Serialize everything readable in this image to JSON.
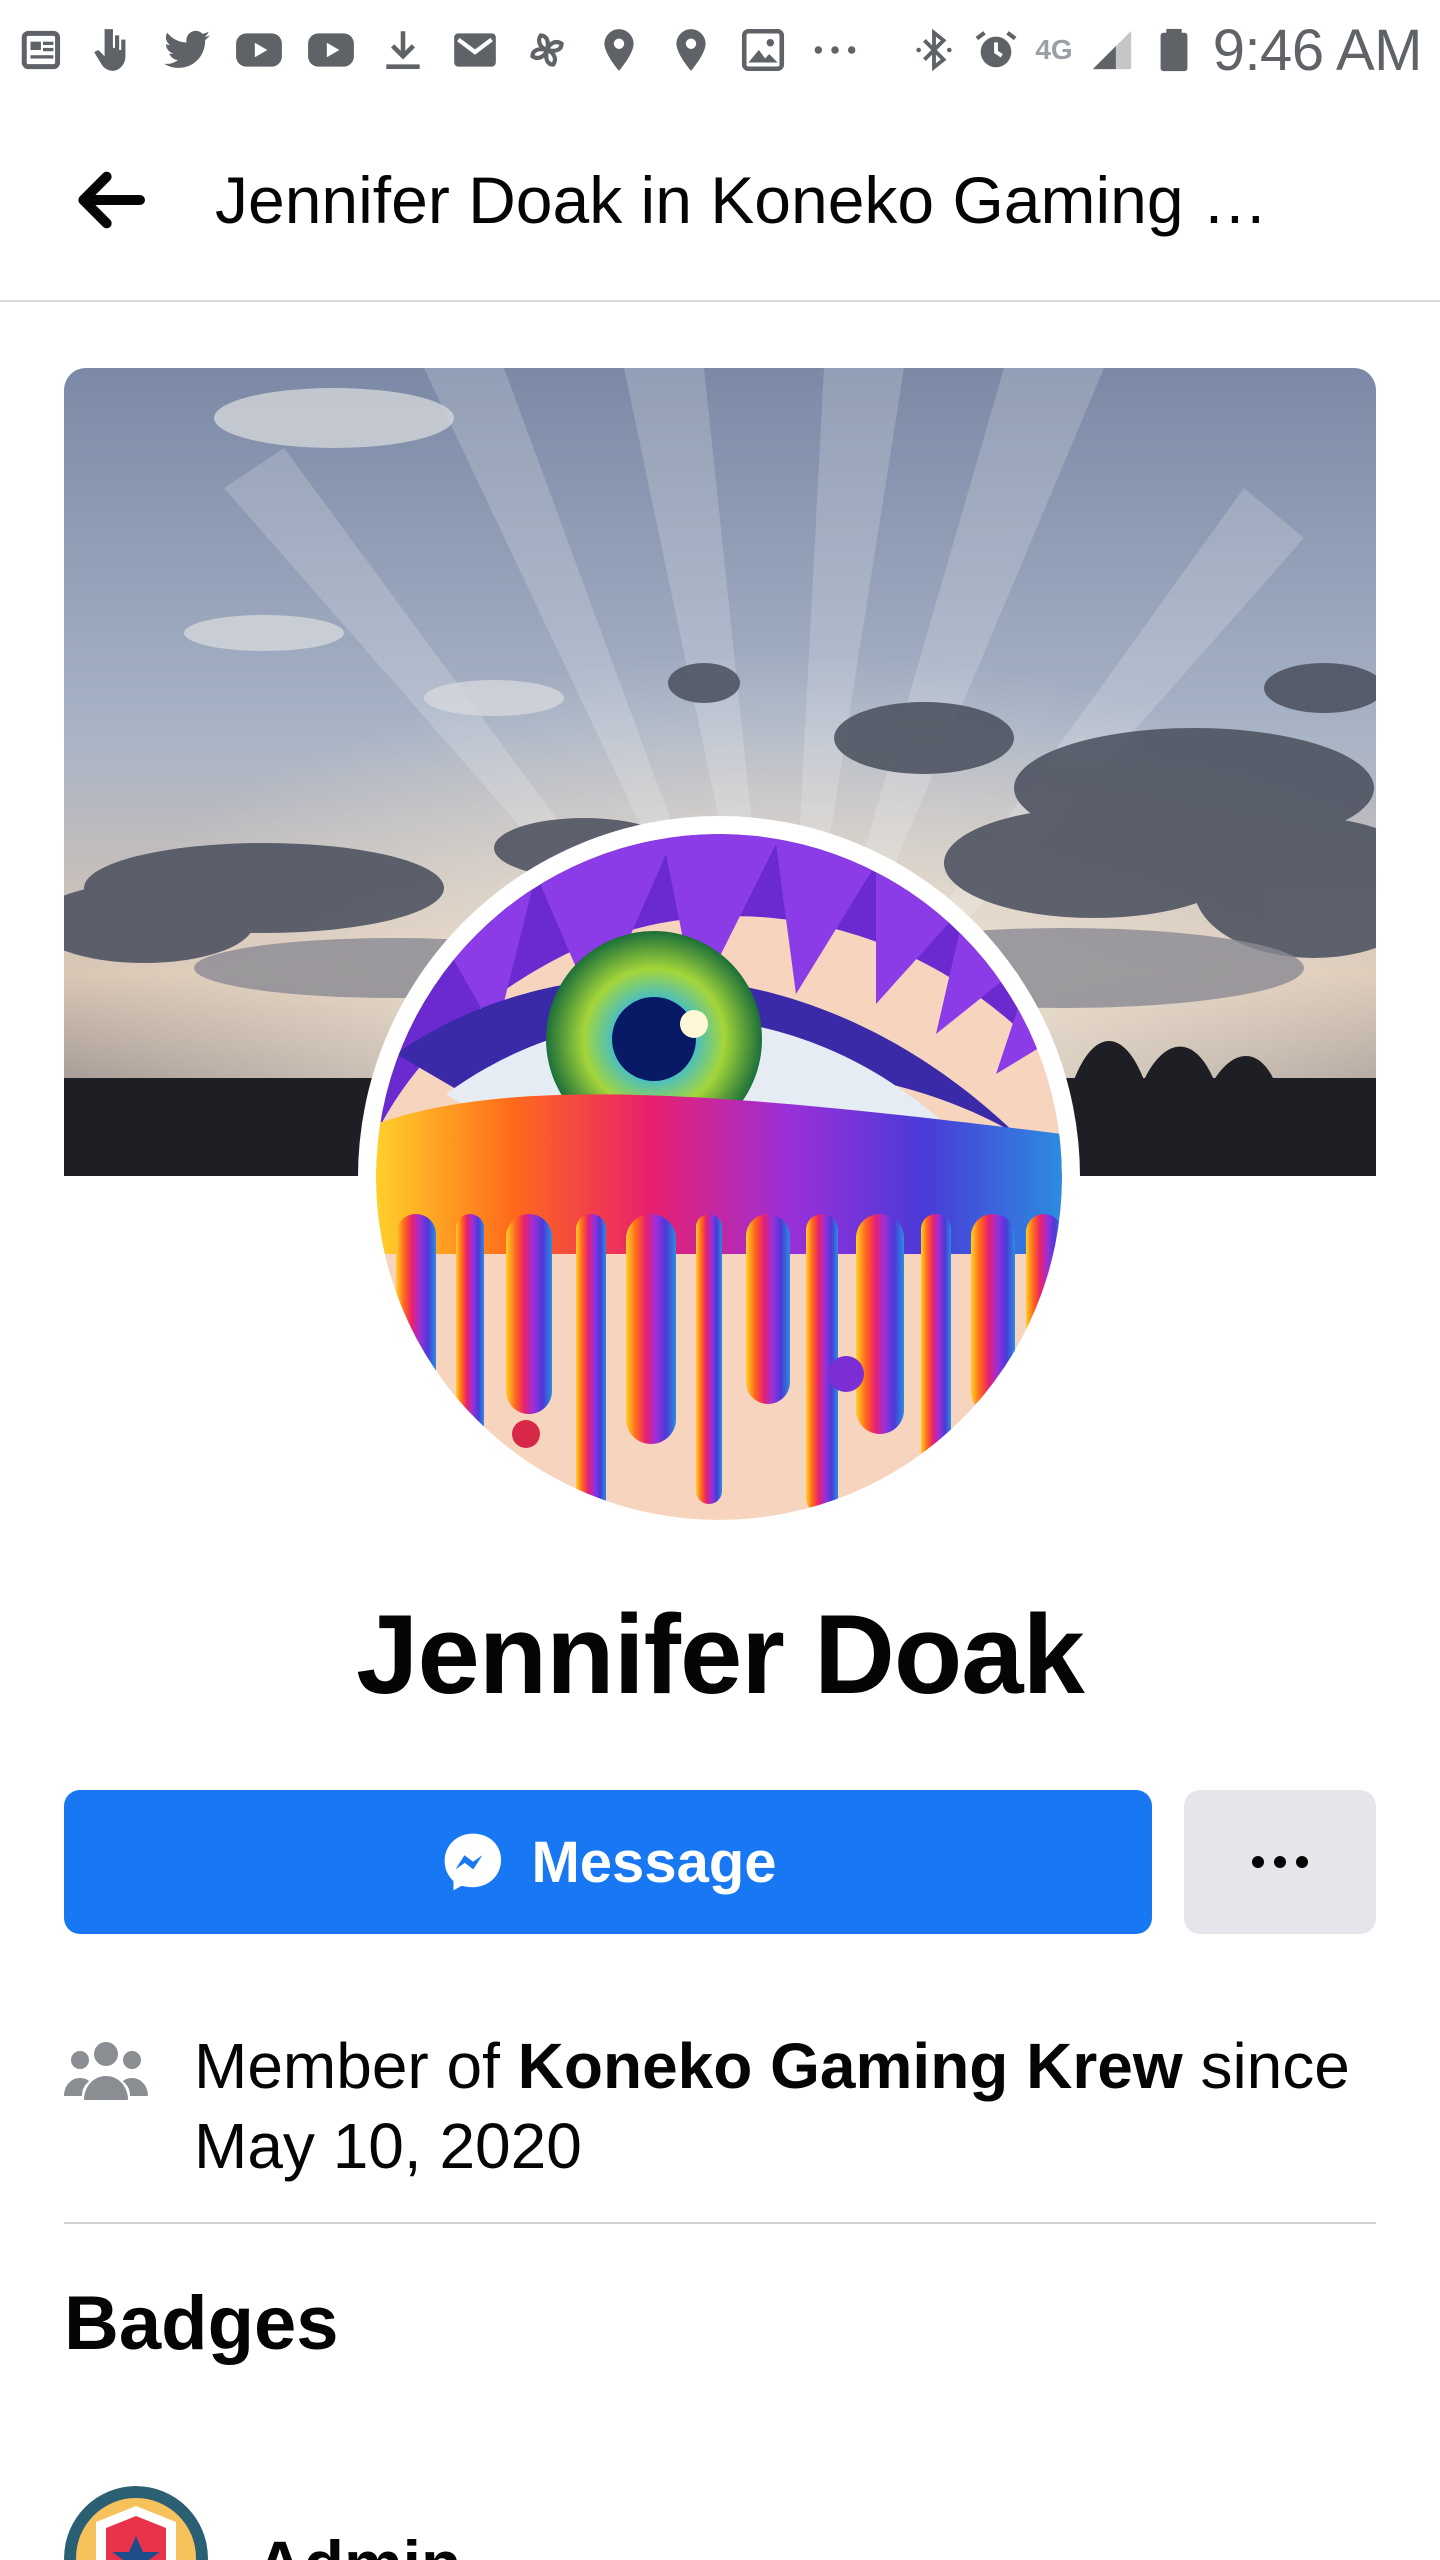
{
  "status_bar": {
    "time": "9:46 AM",
    "network": "4G",
    "icons": [
      "news-icon",
      "hand-icon",
      "twitter-icon",
      "youtube-icon",
      "youtube-icon",
      "download-icon",
      "mail-icon",
      "pinwheel-icon",
      "location-icon",
      "location-icon",
      "image-icon",
      "more-notifications-icon",
      "bluetooth-icon",
      "alarm-icon",
      "signal-icon",
      "battery-icon"
    ]
  },
  "header": {
    "title": "Jennifer Doak in Koneko Gaming Krew",
    "back_icon": "arrow-left-icon"
  },
  "profile": {
    "name": "Jennifer Doak",
    "cover_photo": "sunset-sky-cover-photo",
    "avatar": "rainbow-eye-avatar"
  },
  "actions": {
    "message_label": "Message",
    "message_icon": "messenger-icon",
    "more_icon": "more-dots-icon",
    "accent_color": "#1877f2"
  },
  "membership": {
    "prefix": "Member of ",
    "group": "Koneko Gaming Krew",
    "middle": " since",
    "date": "May 10, 2020",
    "icon": "group-members-icon"
  },
  "badges": {
    "heading": "Badges",
    "items": [
      {
        "label": "Admin",
        "icon": "admin-badge-icon"
      }
    ]
  }
}
